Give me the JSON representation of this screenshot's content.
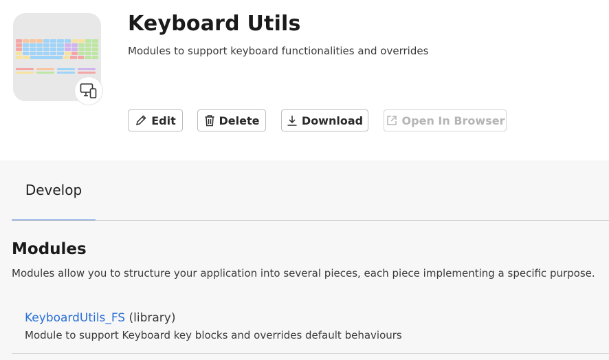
{
  "app": {
    "title": "Keyboard Utils",
    "subtitle": "Modules to support keyboard functionalities and overrides",
    "icon": "keyboard-illustration-icon",
    "badge_icon": "device-icon"
  },
  "actions": {
    "edit": "Edit",
    "delete": "Delete",
    "download": "Download",
    "open_in_browser": "Open In Browser"
  },
  "tabs": [
    {
      "label": "Develop",
      "active": true
    }
  ],
  "modules_section": {
    "title": "Modules",
    "description": "Modules allow you to structure your application into several pieces, each piece implementing a specific purpose.",
    "items": [
      {
        "name": "KeyboardUtils_FS",
        "type": "(library)",
        "description": "Module to support Keyboard key blocks and overrides default behaviours"
      }
    ]
  },
  "colors": {
    "accent": "#2a6fd6",
    "disabled_text": "#b5b5b5"
  }
}
